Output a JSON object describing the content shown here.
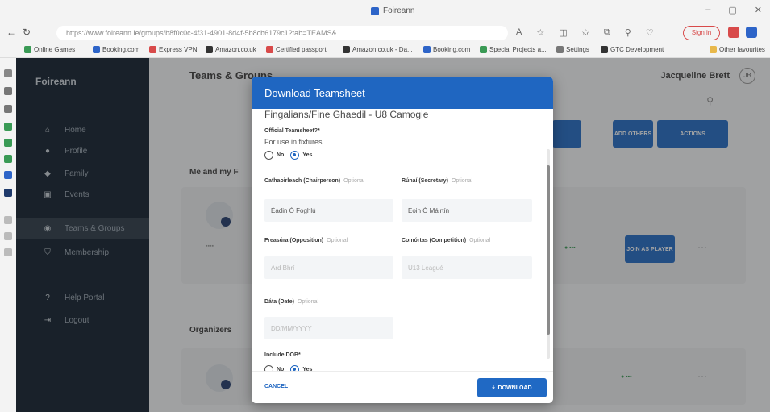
{
  "browser": {
    "window_title": "Foireann",
    "url": "https://www.foireann.ie/groups/b8f0c0c-4f31-4901-8d4f-5b8cb6179c1?tab=TEAMS&...",
    "signin_label": "Sign in",
    "bookmarks": [
      "Online Games",
      "Booking.com",
      "Express VPN",
      "Amazon.co.uk",
      "Certified passport",
      "Amazon.co.uk - Da...",
      "Booking.com",
      "Special Projects a...",
      "Settings",
      "GTC Development",
      "Other favourites"
    ]
  },
  "sidebar": {
    "brand": "Foireann",
    "items": [
      {
        "label": "Home",
        "icon": "home-icon"
      },
      {
        "label": "Profile",
        "icon": "person-icon"
      },
      {
        "label": "Family",
        "icon": "family-icon"
      },
      {
        "label": "Events",
        "icon": "calendar-icon"
      },
      {
        "label": "Teams & Groups",
        "icon": "groups-icon",
        "active": true
      },
      {
        "label": "Membership",
        "icon": "shield-icon"
      },
      {
        "label": "Help Portal",
        "icon": "help-icon"
      },
      {
        "label": "Logout",
        "icon": "logout-icon"
      }
    ]
  },
  "main": {
    "page_title": "Teams & Groups",
    "user_name": "Jacqueline Brett",
    "user_initials": "JB",
    "section_me": "Me and my F",
    "section_organizers": "Organizers",
    "add_others_label": "ADD OTHERS",
    "actions_label": "ACTIONS",
    "join_as_player_label": "JOIN AS PLAYER"
  },
  "modal": {
    "title": "Download Teamsheet",
    "team_name": "Fingalians/Fine Ghaedil - U8 Camogie",
    "official_label": "Official Teamsheet?",
    "official_helper": "For use in fixtures",
    "no_label": "No",
    "yes_label": "Yes",
    "optional_label": "Optional",
    "chairperson_label": "Cathaoirleach (Chairperson)",
    "chairperson_value": "Éadin Ó Foghlú",
    "secretary_label": "Rúnaí (Secretary)",
    "secretary_value": "Eoin Ó Máirtín",
    "opposition_label": "Freasúra (Opposition)",
    "opposition_placeholder": "Ard Bhrí",
    "competition_label": "Comórtas (Competition)",
    "competition_placeholder": "U13 Leagué",
    "date_label": "Dáta (Date)",
    "date_placeholder": "DD/MM/YYYY",
    "dob_label": "Include DOB",
    "cancel_label": "CANCEL",
    "download_label": "DOWNLOAD"
  },
  "colors": {
    "primary": "#1f66c1",
    "sidebar_bg": "#0e1d2b",
    "overlay": "rgba(40,40,40,0.42)"
  }
}
